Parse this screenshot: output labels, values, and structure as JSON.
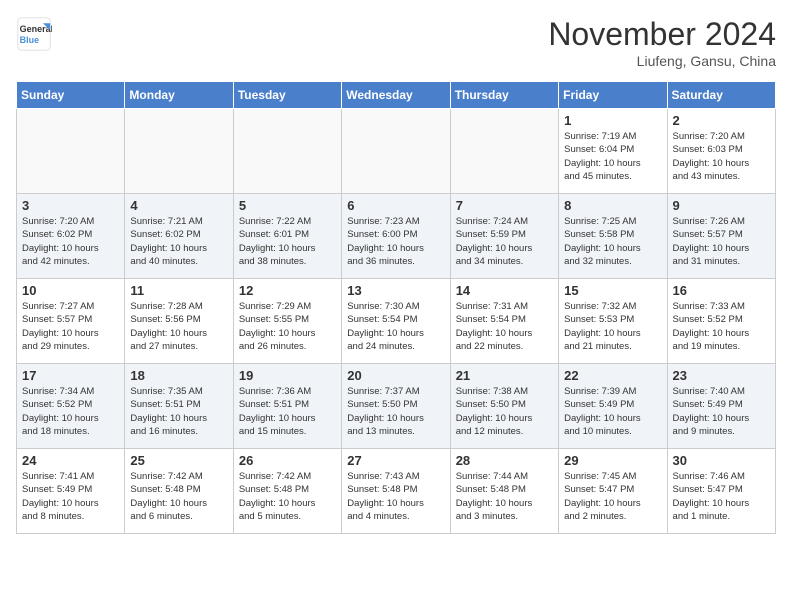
{
  "header": {
    "logo_line1": "General",
    "logo_line2": "Blue",
    "month": "November 2024",
    "location": "Liufeng, Gansu, China"
  },
  "days_of_week": [
    "Sunday",
    "Monday",
    "Tuesday",
    "Wednesday",
    "Thursday",
    "Friday",
    "Saturday"
  ],
  "weeks": [
    [
      {
        "day": "",
        "info": ""
      },
      {
        "day": "",
        "info": ""
      },
      {
        "day": "",
        "info": ""
      },
      {
        "day": "",
        "info": ""
      },
      {
        "day": "",
        "info": ""
      },
      {
        "day": "1",
        "info": "Sunrise: 7:19 AM\nSunset: 6:04 PM\nDaylight: 10 hours\nand 45 minutes."
      },
      {
        "day": "2",
        "info": "Sunrise: 7:20 AM\nSunset: 6:03 PM\nDaylight: 10 hours\nand 43 minutes."
      }
    ],
    [
      {
        "day": "3",
        "info": "Sunrise: 7:20 AM\nSunset: 6:02 PM\nDaylight: 10 hours\nand 42 minutes."
      },
      {
        "day": "4",
        "info": "Sunrise: 7:21 AM\nSunset: 6:02 PM\nDaylight: 10 hours\nand 40 minutes."
      },
      {
        "day": "5",
        "info": "Sunrise: 7:22 AM\nSunset: 6:01 PM\nDaylight: 10 hours\nand 38 minutes."
      },
      {
        "day": "6",
        "info": "Sunrise: 7:23 AM\nSunset: 6:00 PM\nDaylight: 10 hours\nand 36 minutes."
      },
      {
        "day": "7",
        "info": "Sunrise: 7:24 AM\nSunset: 5:59 PM\nDaylight: 10 hours\nand 34 minutes."
      },
      {
        "day": "8",
        "info": "Sunrise: 7:25 AM\nSunset: 5:58 PM\nDaylight: 10 hours\nand 32 minutes."
      },
      {
        "day": "9",
        "info": "Sunrise: 7:26 AM\nSunset: 5:57 PM\nDaylight: 10 hours\nand 31 minutes."
      }
    ],
    [
      {
        "day": "10",
        "info": "Sunrise: 7:27 AM\nSunset: 5:57 PM\nDaylight: 10 hours\nand 29 minutes."
      },
      {
        "day": "11",
        "info": "Sunrise: 7:28 AM\nSunset: 5:56 PM\nDaylight: 10 hours\nand 27 minutes."
      },
      {
        "day": "12",
        "info": "Sunrise: 7:29 AM\nSunset: 5:55 PM\nDaylight: 10 hours\nand 26 minutes."
      },
      {
        "day": "13",
        "info": "Sunrise: 7:30 AM\nSunset: 5:54 PM\nDaylight: 10 hours\nand 24 minutes."
      },
      {
        "day": "14",
        "info": "Sunrise: 7:31 AM\nSunset: 5:54 PM\nDaylight: 10 hours\nand 22 minutes."
      },
      {
        "day": "15",
        "info": "Sunrise: 7:32 AM\nSunset: 5:53 PM\nDaylight: 10 hours\nand 21 minutes."
      },
      {
        "day": "16",
        "info": "Sunrise: 7:33 AM\nSunset: 5:52 PM\nDaylight: 10 hours\nand 19 minutes."
      }
    ],
    [
      {
        "day": "17",
        "info": "Sunrise: 7:34 AM\nSunset: 5:52 PM\nDaylight: 10 hours\nand 18 minutes."
      },
      {
        "day": "18",
        "info": "Sunrise: 7:35 AM\nSunset: 5:51 PM\nDaylight: 10 hours\nand 16 minutes."
      },
      {
        "day": "19",
        "info": "Sunrise: 7:36 AM\nSunset: 5:51 PM\nDaylight: 10 hours\nand 15 minutes."
      },
      {
        "day": "20",
        "info": "Sunrise: 7:37 AM\nSunset: 5:50 PM\nDaylight: 10 hours\nand 13 minutes."
      },
      {
        "day": "21",
        "info": "Sunrise: 7:38 AM\nSunset: 5:50 PM\nDaylight: 10 hours\nand 12 minutes."
      },
      {
        "day": "22",
        "info": "Sunrise: 7:39 AM\nSunset: 5:49 PM\nDaylight: 10 hours\nand 10 minutes."
      },
      {
        "day": "23",
        "info": "Sunrise: 7:40 AM\nSunset: 5:49 PM\nDaylight: 10 hours\nand 9 minutes."
      }
    ],
    [
      {
        "day": "24",
        "info": "Sunrise: 7:41 AM\nSunset: 5:49 PM\nDaylight: 10 hours\nand 8 minutes."
      },
      {
        "day": "25",
        "info": "Sunrise: 7:42 AM\nSunset: 5:48 PM\nDaylight: 10 hours\nand 6 minutes."
      },
      {
        "day": "26",
        "info": "Sunrise: 7:42 AM\nSunset: 5:48 PM\nDaylight: 10 hours\nand 5 minutes."
      },
      {
        "day": "27",
        "info": "Sunrise: 7:43 AM\nSunset: 5:48 PM\nDaylight: 10 hours\nand 4 minutes."
      },
      {
        "day": "28",
        "info": "Sunrise: 7:44 AM\nSunset: 5:48 PM\nDaylight: 10 hours\nand 3 minutes."
      },
      {
        "day": "29",
        "info": "Sunrise: 7:45 AM\nSunset: 5:47 PM\nDaylight: 10 hours\nand 2 minutes."
      },
      {
        "day": "30",
        "info": "Sunrise: 7:46 AM\nSunset: 5:47 PM\nDaylight: 10 hours\nand 1 minute."
      }
    ]
  ]
}
